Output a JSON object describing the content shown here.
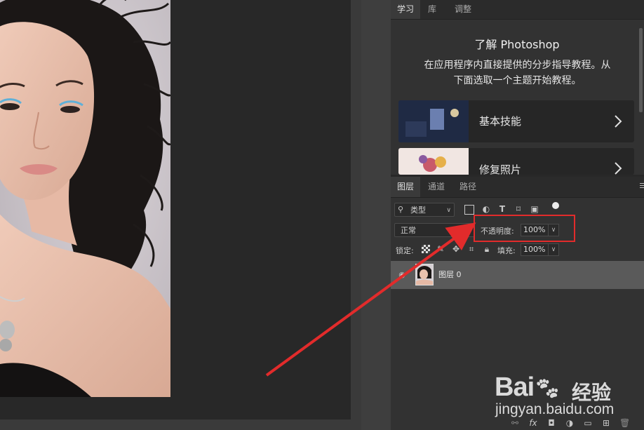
{
  "learn_panel": {
    "tabs": [
      "学习",
      "库",
      "调整"
    ],
    "title": "了解 Photoshop",
    "description_line1": "在应用程序内直接提供的分步指导教程。从",
    "description_line2": "下面选取一个主题开始教程。",
    "cards": [
      {
        "label": "基本技能"
      },
      {
        "label": "修复照片"
      }
    ]
  },
  "layers_panel": {
    "tabs": [
      "图层",
      "通道",
      "路径"
    ],
    "filter_label": "类型",
    "blend_mode": "正常",
    "opacity_label": "不透明度:",
    "opacity_value": "100%",
    "lock_label": "锁定:",
    "fill_label": "填充:",
    "fill_value": "100%",
    "layer_name": "图层 0",
    "bottom_icons": [
      "link-icon",
      "fx-icon",
      "mask-icon",
      "adjustment-icon",
      "folder-icon",
      "new-layer-icon",
      "trash-icon"
    ]
  },
  "watermark": {
    "brand": "Bai",
    "brand_suffix": "经验",
    "url": "jingyan.baidu.com"
  },
  "colors": {
    "annotation": "#e22b2b",
    "panel_bg": "#323232",
    "canvas_bg": "#282828"
  }
}
